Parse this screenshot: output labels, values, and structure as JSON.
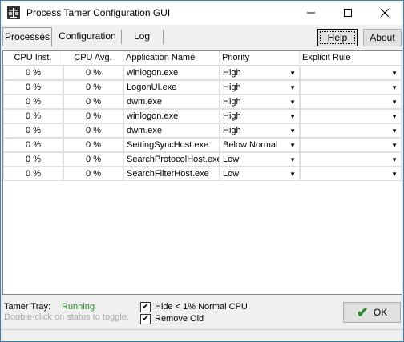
{
  "window": {
    "title": "Process Tamer Configuration GUI"
  },
  "tabs": [
    {
      "label": "Processes"
    },
    {
      "label": "Configuration"
    },
    {
      "label": "Log"
    }
  ],
  "buttons": {
    "help": "Help",
    "about": "About",
    "ok": "OK"
  },
  "table": {
    "headers": [
      "CPU Inst.",
      "CPU Avg.",
      "Application Name",
      "Priority",
      "Explicit Rule"
    ],
    "rows": [
      {
        "cpu_inst": "0 %",
        "cpu_avg": "0 %",
        "app": "winlogon.exe",
        "priority": "High",
        "rule": ""
      },
      {
        "cpu_inst": "0 %",
        "cpu_avg": "0 %",
        "app": "LogonUI.exe",
        "priority": "High",
        "rule": ""
      },
      {
        "cpu_inst": "0 %",
        "cpu_avg": "0 %",
        "app": "dwm.exe",
        "priority": "High",
        "rule": ""
      },
      {
        "cpu_inst": "0 %",
        "cpu_avg": "0 %",
        "app": "winlogon.exe",
        "priority": "High",
        "rule": ""
      },
      {
        "cpu_inst": "0 %",
        "cpu_avg": "0 %",
        "app": "dwm.exe",
        "priority": "High",
        "rule": ""
      },
      {
        "cpu_inst": "0 %",
        "cpu_avg": "0 %",
        "app": "SettingSyncHost.exe",
        "priority": "Below Normal",
        "rule": ""
      },
      {
        "cpu_inst": "0 %",
        "cpu_avg": "0 %",
        "app": "SearchProtocolHost.exe",
        "priority": "Low",
        "rule": ""
      },
      {
        "cpu_inst": "0 %",
        "cpu_avg": "0 %",
        "app": "SearchFilterHost.exe",
        "priority": "Low",
        "rule": ""
      }
    ]
  },
  "status": {
    "tray_label": "Tamer Tray:",
    "tray_status": "Running",
    "tray_hint": "Double-click on status to toggle.",
    "hide_label": "Hide < 1% Normal CPU",
    "hide_checked": true,
    "remove_label": "Remove Old",
    "remove_checked": true
  },
  "colors": {
    "running": "#2e8b2e",
    "accent": "#3c7fb1"
  },
  "icons": [
    "scales-app-icon",
    "minimize-icon",
    "maximize-icon",
    "close-icon",
    "dropdown-arrow-icon",
    "checkmark-icon"
  ]
}
